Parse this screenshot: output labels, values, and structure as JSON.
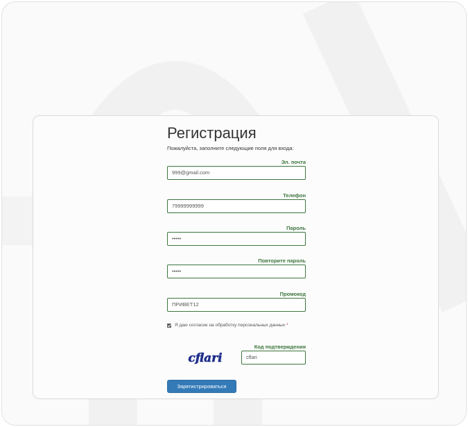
{
  "form": {
    "title": "Регистрация",
    "subtitle": "Пожалуйста, заполните следующие поля для входа:",
    "fields": [
      {
        "label": "Эл. почта",
        "value": "999@gmail.com"
      },
      {
        "label": "Телефон",
        "value": "79999999999"
      },
      {
        "label": "Пароль",
        "value": "•••••"
      },
      {
        "label": "Повторите пароль",
        "value": "•••••"
      },
      {
        "label": "Промокод",
        "value": "ПРИВЕТ12"
      }
    ],
    "consent": {
      "text": "Я даю согласие на обработку персональных данных",
      "required_mark": "*",
      "checked": true
    },
    "captcha": {
      "image_text": "cflari",
      "label": "Код подтверждения",
      "value": "cflari"
    },
    "submit_label": "Зарегистрироваться"
  },
  "colors": {
    "accent": "#337ab7",
    "success_green": "#3c763d",
    "captcha_blue": "#1f2f8c"
  }
}
